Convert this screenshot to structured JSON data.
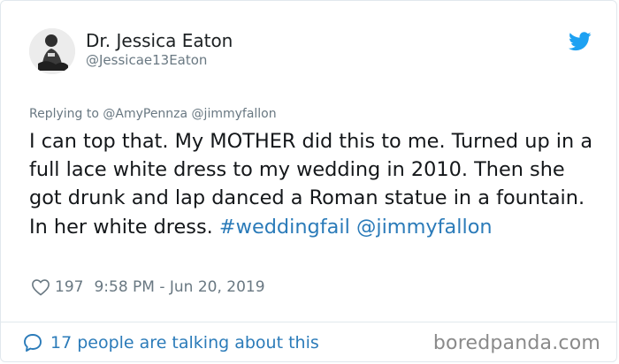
{
  "author": {
    "display_name": "Dr. Jessica Eaton",
    "handle": "@Jessicae13Eaton"
  },
  "reply_to": "Replying to @AmyPennza @jimmyfallon",
  "tweet": {
    "text": "I can top that. My MOTHER did this to me. Turned up in a full lace white dress to my wedding in 2010. Then she got drunk and lap danced a Roman statue in a fountain. In her white dress.",
    "hashtag": "#weddingfail",
    "mention": "@jimmyfallon"
  },
  "meta": {
    "like_count": "197",
    "timestamp": "9:58 PM - Jun 20, 2019"
  },
  "footer": {
    "conversation_label": "17 people are talking about this"
  },
  "watermark": "boredpanda.com",
  "colors": {
    "twitter_blue": "#1da1f2",
    "link_blue": "#2b7bb9",
    "secondary_text": "#697882",
    "border": "#e1e8ed"
  },
  "icons": [
    "twitter-bird-icon",
    "heart-icon",
    "speech-bubble-icon"
  ]
}
